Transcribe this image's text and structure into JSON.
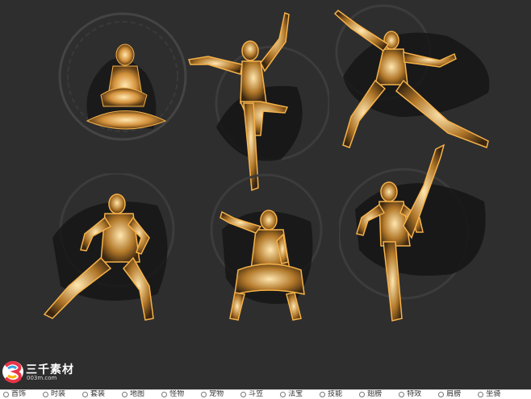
{
  "figures": [
    {
      "id": "fig-1",
      "pose": "seated-meditation"
    },
    {
      "id": "fig-2",
      "pose": "one-leg-stance"
    },
    {
      "id": "fig-3",
      "pose": "flying-kick"
    },
    {
      "id": "fig-4",
      "pose": "horse-stance"
    },
    {
      "id": "fig-5",
      "pose": "crouch"
    },
    {
      "id": "fig-6",
      "pose": "high-kick"
    }
  ],
  "colors": {
    "background": "#2e2e2e",
    "glow": "#f6b24a",
    "glow_core": "#ffe7b0",
    "ink": "#111111"
  },
  "logo": {
    "title": "三千素材",
    "subtitle": "003m.com",
    "mark": "3"
  },
  "nav": {
    "items": [
      "首饰",
      "时装",
      "套装",
      "地图",
      "怪物",
      "宠物",
      "斗笠",
      "法宝",
      "技能",
      "翅膀",
      "特效",
      "肩膀",
      "坐骑"
    ]
  }
}
